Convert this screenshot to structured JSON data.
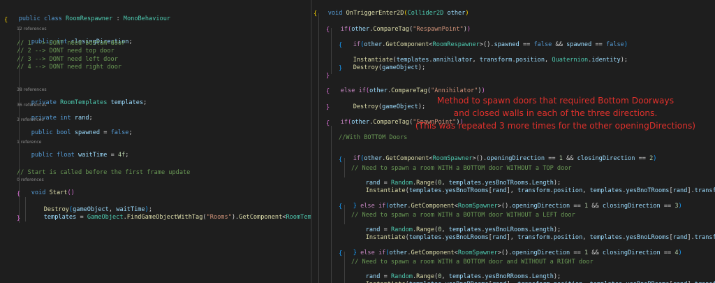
{
  "left_editor": {
    "ref_labels": {
      "closing": "12 references",
      "templates": "38 references",
      "rand": "36 references",
      "spawned": "3 references",
      "waittime": "1 reference",
      "start": "0 references"
    },
    "lines": {
      "class_decl": "public class RoomRespawner : MonoBehaviour",
      "open_brace": "{",
      "closing_direction": "public int closingDirection;",
      "c1": "// 1 --> DONT need bottom door",
      "c2": "// 2 --> DONT need top door",
      "c3": "// 3 --> DONT need left door",
      "c4": "// 4 --> DONT need right door",
      "templates": "private RoomTemplates templates;",
      "rand": "private int rand;",
      "spawned": "public bool spawned = false;",
      "waittime": "public float waitTime = 4f;",
      "start_comment": "// Start is called before the first frame update",
      "start_decl": "void Start()",
      "start_open": "{",
      "destroy": "Destroy(gameObject, waitTime);",
      "templates_assign": "templates = GameObject.FindGameObjectWithTag(\"Rooms\").GetComponent<RoomTemplates>();",
      "start_close": "}"
    }
  },
  "right_editor": {
    "lines": {
      "method_decl": "void OnTriggerEnter2D(Collider2D other)",
      "open": "{",
      "if_respawn": "if(other.CompareTag(\"RespawnPoint\"))",
      "brace_a": "{",
      "if_spawned": "if(other.GetComponent<RoomRespawner>().spawned == false && spawned == false)",
      "brace_b": "{",
      "instantiate_annih": "Instantiate(templates.annihilator, transform.position, Quaternion.identity);",
      "destroy1": "Destroy(gameObject);",
      "brace_c": "}",
      "brace_d": "}",
      "elseif_annih": "else if(other.CompareTag(\"Annihilator\"))",
      "brace_e": "{",
      "destroy2": "Destroy(gameObject);",
      "brace_f": "}",
      "if_spawnpoint": "if(other.CompareTag(\"SpawnPoint\"))",
      "brace_g": "{",
      "with_bottom": "//With BOTTOM Doors",
      "if_dir2": "if(other.GetComponent<RoomSpawner>().openingDirection == 1 && closingDirection == 2)",
      "brace_h": "{",
      "cm_top": "// Need to spawn a room WITH a BOTTOM door WITHOUT a TOP door",
      "rand_bnot": "rand = Random.Range(0, templates.yesBnoTRooms.Length);",
      "inst_bnot": "Instantiate(templates.yesBnoTRooms[rand], transform.position, templates.yesBnoTRooms[rand].transform.rotation);",
      "elseif_dir3": "} else if(other.GetComponent<RoomSpawner>().openingDirection == 1 && closingDirection == 3)",
      "brace_i": "{",
      "cm_left": "// Need to spawn a room WITH a BOTTOM door WITHOUT a LEFT door",
      "rand_bnol": "rand = Random.Range(0, templates.yesBnoLRooms.Length);",
      "inst_bnol": "Instantiate(templates.yesBnoLRooms[rand], transform.position, templates.yesBnoLRooms[rand].transform.rotation);",
      "elseif_dir4": "} else if(other.GetComponent<RoomSpawner>().openingDirection == 1 && closingDirection == 4)",
      "brace_j": "{",
      "cm_right": "// Need to spawn a room WITH a BOTTOM door and WITHOUT a RIGHT door",
      "rand_bnor": "rand = Random.Range(0, templates.yesBnoRRooms.Length);",
      "inst_bnor": "Instantiate(templates.yesBnoRRooms[rand], transform.position, templates.yesBnoRRooms[rand].transform.rotation);"
    }
  },
  "annotation": {
    "line1": "Method to spawn doors that required Bottom Doorways",
    "line2": "and closed walls in each of the three directions.",
    "line3": "(This was repeated 3 more times for the other openingDirections)",
    "color": "#e0312c"
  },
  "theme": {
    "background": "#1e1e1e",
    "keyword": "#569cd6",
    "type": "#4ec9b0",
    "method": "#dcdcaa",
    "string": "#ce9178",
    "comment": "#6a9955"
  }
}
